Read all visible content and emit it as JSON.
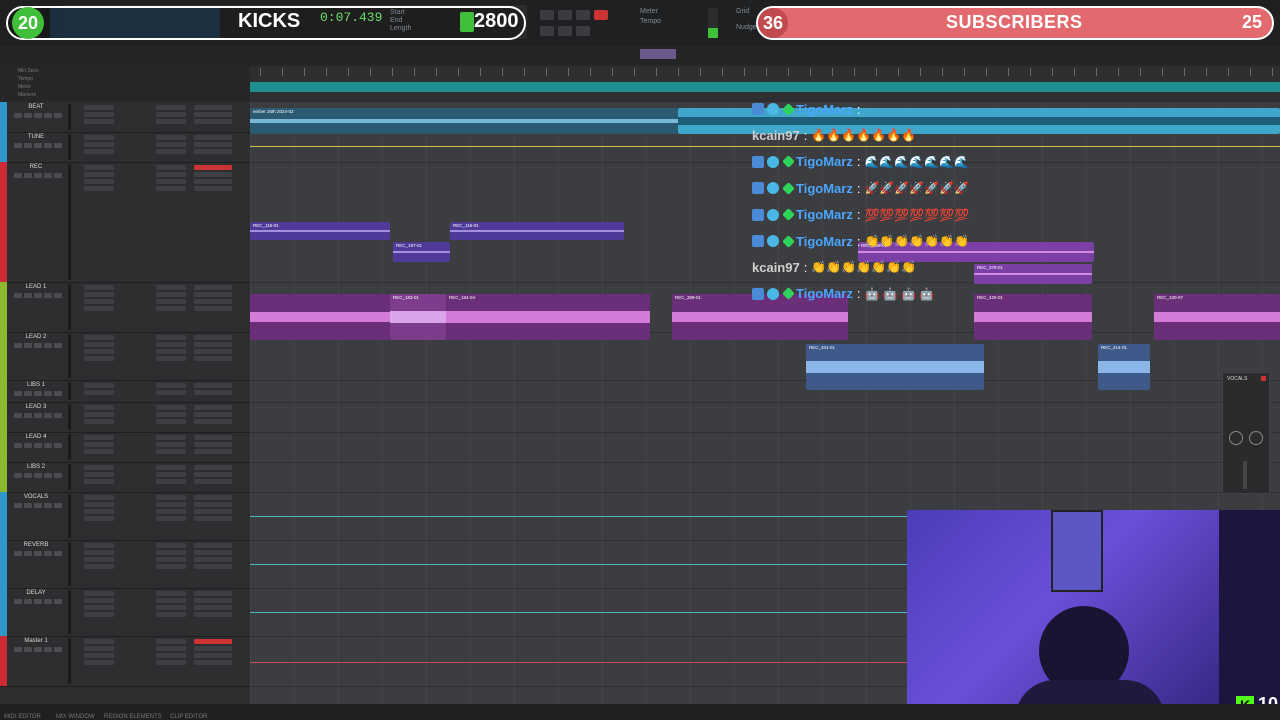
{
  "overlay": {
    "followers_current": "20",
    "label_left": "KICKS",
    "timecode": "0:07.439",
    "followers_goal": "2800",
    "subs_current": "36",
    "subs_label": "SUBSCRIBERS",
    "subs_goal": "25",
    "kick_viewers": "10",
    "progress_fraction": 0.01
  },
  "transport": {
    "labels": [
      "Start",
      "End",
      "Length"
    ],
    "nudge": "Nudge",
    "grid": "Grid",
    "meter": "Meter",
    "tempo": "Tempo"
  },
  "ruler_labels": [
    "Min:Secs",
    "Tempo",
    "Meter",
    "Markers"
  ],
  "tracks": [
    {
      "name": "BEAT",
      "color": "#2f97c9",
      "height": 30
    },
    {
      "name": "TUNE",
      "color": "#2f97c9",
      "height": 30
    },
    {
      "name": "REC",
      "color": "#cc2b35",
      "height": 120
    },
    {
      "name": "LEAD 1",
      "color": "#8bb82c",
      "height": 50
    },
    {
      "name": "LEAD 2",
      "color": "#8bb82c",
      "height": 48
    },
    {
      "name": "LIBS 1",
      "color": "#8bb82c",
      "height": 22
    },
    {
      "name": "LEAD 3",
      "color": "#8bb82c",
      "height": 30
    },
    {
      "name": "LEAD 4",
      "color": "#8bb82c",
      "height": 30
    },
    {
      "name": "LIBS 2",
      "color": "#8bb82c",
      "height": 30
    },
    {
      "name": "VOCALS",
      "color": "#2f97c9",
      "height": 48
    },
    {
      "name": "REVERB",
      "color": "#2f97c9",
      "height": 48
    },
    {
      "name": "DELAY",
      "color": "#2f97c9",
      "height": 48
    },
    {
      "name": "Master 1",
      "color": "#cc2b35",
      "height": 50
    }
  ],
  "clips": {
    "beat_name": "ember 26th 2024-02",
    "rec": [
      "REC_115-01",
      "REC_116-01",
      "REC_197-01",
      "REC_188-01",
      "REC_378-01"
    ],
    "lead1": [
      "REC_183-01",
      "REC_184-04",
      "REC_389-01",
      "REC_425-01",
      "REC_100-07"
    ],
    "lead2": [
      "REC_401-01",
      "REC_414-01"
    ]
  },
  "chat": [
    {
      "user": "TigoMarz",
      "badges": true,
      "text": ""
    },
    {
      "user": "kcain97",
      "badges": false,
      "text": "🔥🔥🔥🔥🔥🔥🔥"
    },
    {
      "user": "TigoMarz",
      "badges": true,
      "text": "🌊🌊🌊🌊🌊🌊🌊"
    },
    {
      "user": "TigoMarz",
      "badges": true,
      "text": "🚀🚀🚀🚀🚀🚀🚀"
    },
    {
      "user": "TigoMarz",
      "badges": true,
      "text": "💯💯💯💯💯💯💯"
    },
    {
      "user": "TigoMarz",
      "badges": true,
      "text": "👏👏👏👏👏👏👏"
    },
    {
      "user": "kcain97",
      "badges": false,
      "text": "👏👏👏👏👏👏👏"
    },
    {
      "user": "TigoMarz",
      "badges": true,
      "text": "🤖 🤖 🤖 🤖"
    }
  ],
  "plugin": {
    "title": "VOCALS"
  },
  "statusbar": [
    "MIDI EDITOR",
    "MIX WINDOW",
    "REGION ELEMENTS",
    "CLIP EDITOR"
  ],
  "colors": {
    "accent_green": "#3fbf3a",
    "subs_red": "#e26a6e",
    "rec_red": "#cc2b35",
    "beat_blue": "#2f97c9",
    "vocal_purple": "#7b3fa6",
    "kick_green": "#53fc18"
  }
}
